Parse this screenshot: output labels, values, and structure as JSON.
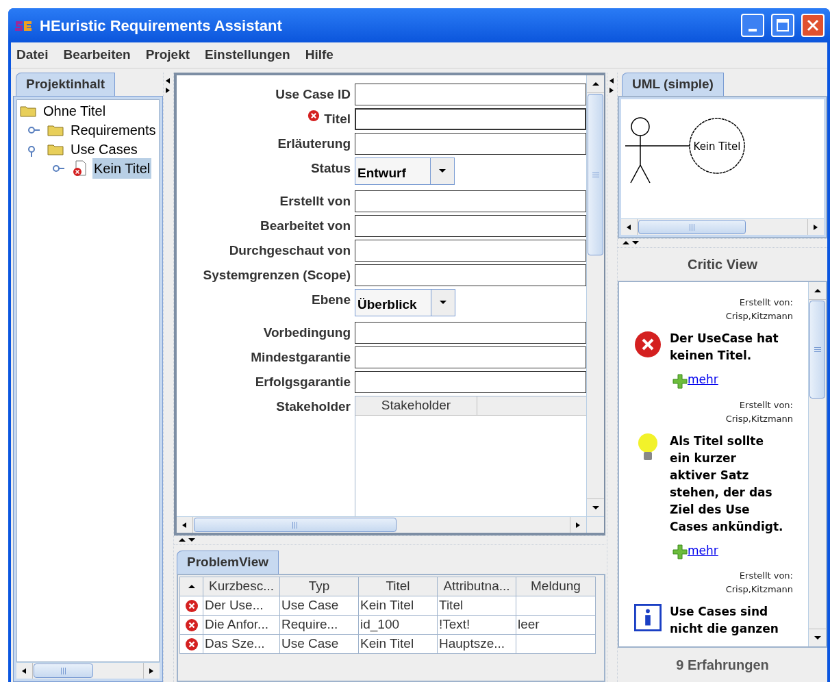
{
  "window": {
    "title": "HEuristic Requirements Assistant"
  },
  "menu": [
    "Datei",
    "Bearbeiten",
    "Projekt",
    "Einstellungen",
    "Hilfe"
  ],
  "project_panel": {
    "tab": {
      "label": "Projektinhalt",
      "selected": true
    },
    "tree": [
      {
        "label": "Ohne Titel",
        "kind": "folder",
        "selected": false,
        "children": [
          {
            "label": "Requirements",
            "kind": "folder",
            "selected": false,
            "expanded": false
          },
          {
            "label": "Use Cases",
            "kind": "folder",
            "selected": false,
            "expanded": true,
            "children": [
              {
                "label": "Kein Titel",
                "kind": "document-error",
                "selected": true,
                "expanded": false
              }
            ]
          }
        ]
      }
    ]
  },
  "form": {
    "fields": [
      {
        "label": "Use Case ID",
        "kind": "text",
        "error": false
      },
      {
        "label": "Titel",
        "kind": "text",
        "error": true
      },
      {
        "label": "Erläuterung",
        "kind": "text",
        "error": false
      },
      {
        "label": "Status",
        "kind": "dropdown",
        "error": false,
        "value": "Entwurf"
      },
      {
        "label": "Erstellt von",
        "kind": "text",
        "error": false
      },
      {
        "label": "Bearbeitet von",
        "kind": "text",
        "error": false
      },
      {
        "label": "Durchgeschaut von",
        "kind": "text",
        "error": false
      },
      {
        "label": "Systemgrenzen (Scope)",
        "kind": "text",
        "error": false
      },
      {
        "label": "Ebene",
        "kind": "dropdown",
        "error": false,
        "value": "Überblick"
      },
      {
        "label": "Vorbedingung",
        "kind": "text",
        "error": false
      },
      {
        "label": "Mindestgarantie",
        "kind": "text",
        "error": false
      },
      {
        "label": "Erfolgsgarantie",
        "kind": "text",
        "error": false
      },
      {
        "label": "Stakeholder",
        "kind": "table",
        "error": false,
        "columns": [
          "Stakeholder"
        ]
      }
    ]
  },
  "problem_view": {
    "tab": {
      "label": "ProblemView",
      "selected": true
    },
    "columns": [
      "Kurzbesc...",
      "Typ",
      "Titel",
      "Attributna...",
      "Meldung"
    ],
    "rows": [
      {
        "error": true,
        "cells": [
          "Der Use...",
          "Use Case",
          "Kein Titel",
          "Titel"
        ]
      },
      {
        "error": true,
        "cells": [
          "Die Anfor...",
          "Require...",
          "id_100",
          "!Text!",
          "leer"
        ]
      },
      {
        "error": true,
        "cells": [
          "Das Sze...",
          "Use Case",
          "Kein Titel",
          "Hauptsze..."
        ]
      }
    ]
  },
  "uml": {
    "tab": {
      "label": "UML (simple)",
      "selected": true
    },
    "use_case": "Kein Titel"
  },
  "critic_view": {
    "title": "Critic View",
    "items": [
      {
        "kind": "error",
        "author_label": "Erstellt von:",
        "author": "Crisp,Kitzmann",
        "message": "Der UseCase hat keinen Titel.",
        "link": "mehr"
      },
      {
        "kind": "hint",
        "author_label": "Erstellt von:",
        "author": "Crisp,Kitzmann",
        "message": "Als Titel sollte ein kurzer aktiver Satz stehen, der das Ziel des Use Cases ankündigt.",
        "link": "mehr"
      },
      {
        "kind": "info",
        "author_label": "Erstellt von:",
        "author": "Crisp,Kitzmann",
        "message": "Use Cases sind nicht die ganzen"
      }
    ],
    "footer": "9 Erfahrungen"
  }
}
